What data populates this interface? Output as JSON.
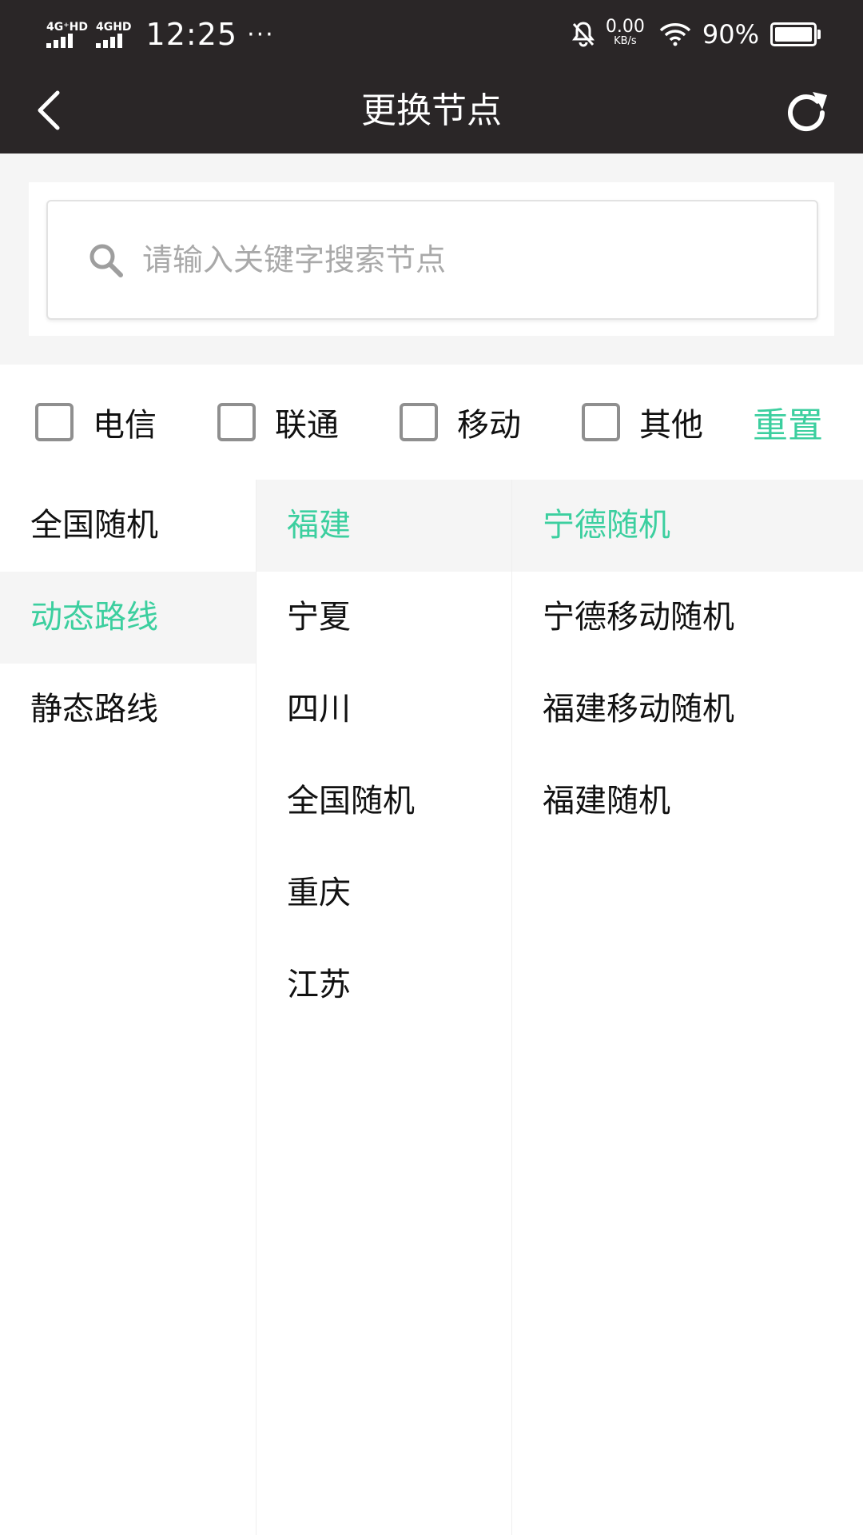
{
  "status_bar": {
    "net1_label": "4G⁺HD",
    "net2_label": "4GHD",
    "time": "12:25",
    "dots": "···",
    "speed_value": "0.00",
    "speed_unit": "KB/s",
    "battery": "90%"
  },
  "nav": {
    "title": "更换节点"
  },
  "search": {
    "placeholder": "请输入关键字搜索节点"
  },
  "filters": {
    "items": [
      {
        "label": "电信"
      },
      {
        "label": "联通"
      },
      {
        "label": "移动"
      },
      {
        "label": "其他"
      }
    ],
    "reset_label": "重置"
  },
  "columns": {
    "col1": [
      "全国随机",
      "动态路线",
      "静态路线"
    ],
    "col2": [
      "福建",
      "宁夏",
      "四川",
      "全国随机",
      "重庆",
      "江苏"
    ],
    "col3": [
      "宁德随机",
      "宁德移动随机",
      "福建移动随机",
      "福建随机"
    ]
  },
  "colors": {
    "accent": "#3ccf9f",
    "header_bg": "#2a2627"
  }
}
